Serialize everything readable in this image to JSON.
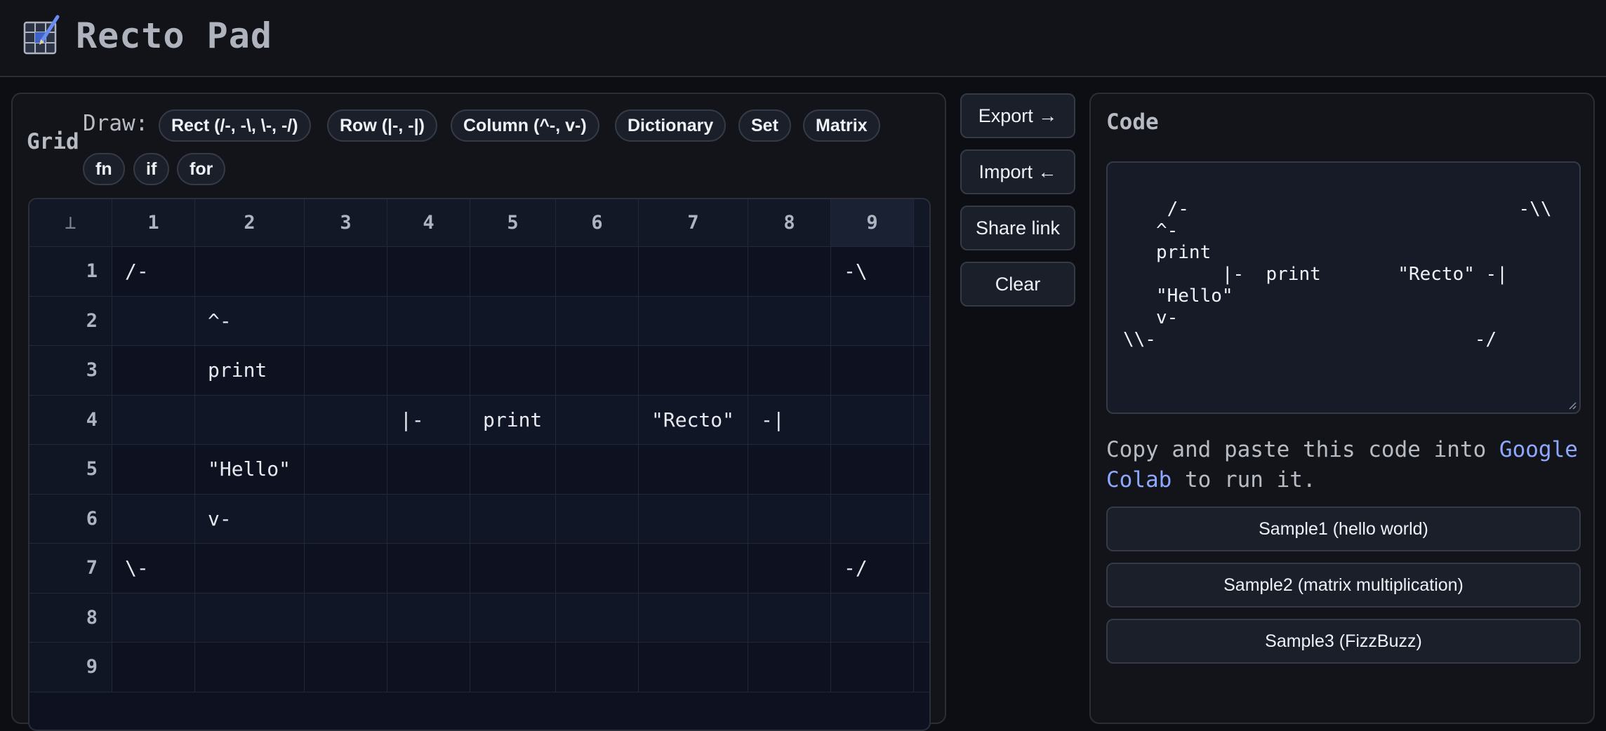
{
  "app": {
    "title": "Recto Pad"
  },
  "grid": {
    "label": "Grid",
    "draw_label": "Draw:",
    "tools": [
      "Rect (/-, -\\, \\-, -/)",
      "Row (|-, -|)",
      "Column (^-, v-)",
      "Dictionary",
      "Set",
      "Matrix",
      "fn",
      "if",
      "for"
    ],
    "corner": "⊥",
    "columns": [
      "1",
      "2",
      "3",
      "4",
      "5",
      "6",
      "7",
      "8",
      "9"
    ],
    "rows": [
      "1",
      "2",
      "3",
      "4",
      "5",
      "6",
      "7",
      "8",
      "9"
    ],
    "cells": [
      [
        "/-",
        "",
        "",
        "",
        "",
        "",
        "",
        "",
        "-\\"
      ],
      [
        "",
        "^-",
        "",
        "",
        "",
        "",
        "",
        "",
        ""
      ],
      [
        "",
        "print",
        "",
        "",
        "",
        "",
        "",
        "",
        ""
      ],
      [
        "",
        "",
        "",
        "|-",
        "print",
        "",
        "\"Recto\"",
        "-|",
        ""
      ],
      [
        "",
        "\"Hello\"",
        "",
        "",
        "",
        "",
        "",
        "",
        ""
      ],
      [
        "",
        "v-",
        "",
        "",
        "",
        "",
        "",
        "",
        ""
      ],
      [
        "\\-",
        "",
        "",
        "",
        "",
        "",
        "",
        "",
        "-/"
      ],
      [
        "",
        "",
        "",
        "",
        "",
        "",
        "",
        "",
        ""
      ],
      [
        "",
        "",
        "",
        "",
        "",
        "",
        "",
        "",
        ""
      ]
    ]
  },
  "actions": {
    "export": "Export →",
    "import": "Import ←",
    "share": "Share link",
    "clear": "Clear"
  },
  "code": {
    "title": "Code",
    "content": "/-                              -\\\\\n   ^-\n   print\n         |-  print       \"Recto\" -|\n   \"Hello\"\n   v-\n\\\\-                             -/",
    "hint_prefix": "Copy and paste this code into ",
    "hint_link": "Google Colab",
    "hint_suffix": " to run it.",
    "samples": [
      "Sample1 (hello world)",
      "Sample2 (matrix multiplication)",
      "Sample3 (FizzBuzz)"
    ]
  },
  "colors": {
    "background": "#0c0e13",
    "panel": "#121419",
    "accent_link": "#8fa8ff",
    "active_column": "#1a2133"
  }
}
